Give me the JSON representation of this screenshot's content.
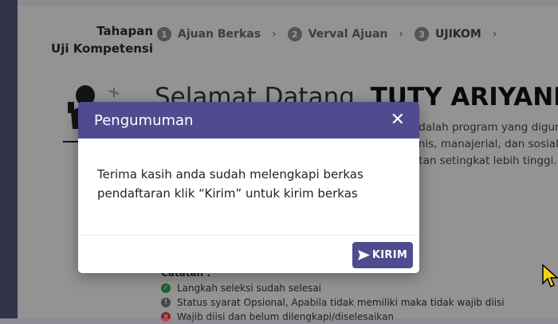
{
  "header": {
    "title_line1": "Tahapan",
    "title_line2": "Uji Kompetensi",
    "steps": [
      {
        "num": "1",
        "label": "Ajuan Berkas"
      },
      {
        "num": "2",
        "label": "Verval Ajuan"
      },
      {
        "num": "3",
        "label": "UJIKOM"
      }
    ],
    "separator": "›"
  },
  "welcome": {
    "prefix": "Selamat Datang,",
    "name": "TUTY ARIYANI"
  },
  "description_lines": [
    "adalah program yang digun",
    "knis, manajerial, dan sosial",
    "atan setingkat lebih tinggi."
  ],
  "notes": {
    "title": "Catatan :",
    "items": [
      {
        "status": "green",
        "text": "Langkah seleksi sudah selesai"
      },
      {
        "status": "grey",
        "text": "Status syarat Opsional, Apabila tidak memiliki maka tidak wajib diisi"
      },
      {
        "status": "red",
        "text": "Wajib diisi dan belum dilengkapi/diselesaikan"
      }
    ]
  },
  "modal": {
    "title": "Pengumuman",
    "close_symbol": "✕",
    "body_line1": "Terima kasih anda sudah melengkapi berkas",
    "body_line2": "pendaftaran klik “Kirim” untuk kirim berkas",
    "submit_label": "KIRIM"
  },
  "colors": {
    "brand": "#4f4b8e",
    "sidebar": "#56567a",
    "success": "#3aa14a",
    "danger": "#d23c3c"
  }
}
